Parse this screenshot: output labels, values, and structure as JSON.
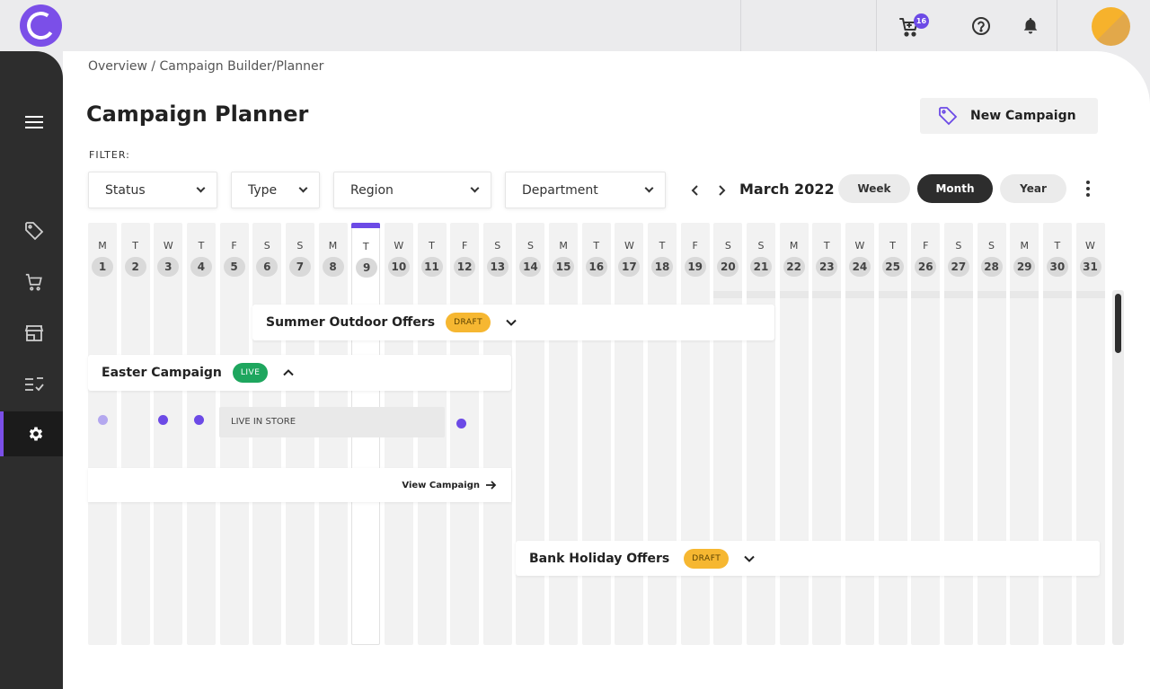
{
  "topbar": {
    "cart_count": "16"
  },
  "breadcrumb": "Overview / Campaign Builder/Planner",
  "page_title": "Campaign Planner",
  "new_campaign_label": "New Campaign",
  "filter": {
    "label": "FILTER:",
    "status": "Status",
    "type": "Type",
    "region": "Region",
    "department": "Department"
  },
  "calendar_nav": {
    "month_label": "March 2022",
    "views": {
      "week": "Week",
      "month": "Month",
      "year": "Year"
    },
    "active_view": "Month"
  },
  "days": [
    {
      "l": "M",
      "n": "1"
    },
    {
      "l": "T",
      "n": "2"
    },
    {
      "l": "W",
      "n": "3"
    },
    {
      "l": "T",
      "n": "4"
    },
    {
      "l": "F",
      "n": "5"
    },
    {
      "l": "S",
      "n": "6"
    },
    {
      "l": "S",
      "n": "7"
    },
    {
      "l": "M",
      "n": "8"
    },
    {
      "l": "T",
      "n": "9"
    },
    {
      "l": "W",
      "n": "10"
    },
    {
      "l": "T",
      "n": "11"
    },
    {
      "l": "F",
      "n": "12"
    },
    {
      "l": "S",
      "n": "13"
    },
    {
      "l": "S",
      "n": "14"
    },
    {
      "l": "M",
      "n": "15"
    },
    {
      "l": "T",
      "n": "16"
    },
    {
      "l": "W",
      "n": "17"
    },
    {
      "l": "T",
      "n": "18"
    },
    {
      "l": "F",
      "n": "19"
    },
    {
      "l": "S",
      "n": "20"
    },
    {
      "l": "S",
      "n": "21"
    },
    {
      "l": "M",
      "n": "22"
    },
    {
      "l": "T",
      "n": "23"
    },
    {
      "l": "W",
      "n": "24"
    },
    {
      "l": "T",
      "n": "25"
    },
    {
      "l": "F",
      "n": "26"
    },
    {
      "l": "S",
      "n": "27"
    },
    {
      "l": "S",
      "n": "28"
    },
    {
      "l": "M",
      "n": "29"
    },
    {
      "l": "T",
      "n": "30"
    },
    {
      "l": "W",
      "n": "31"
    }
  ],
  "today": "9",
  "campaigns": {
    "summer": {
      "title": "Summer Outdoor Offers",
      "status": "DRAFT"
    },
    "easter": {
      "title": "Easter Campaign",
      "status": "LIVE",
      "event_label": "LIVE IN STORE",
      "view_link": "View Campaign"
    },
    "bank_holiday": {
      "title": "Bank Holiday Offers",
      "status": "DRAFT"
    }
  },
  "colors": {
    "accent": "#6c4ae6",
    "sidebar": "#2d2d2d",
    "draft": "#f6b731",
    "live": "#1ea65e"
  }
}
